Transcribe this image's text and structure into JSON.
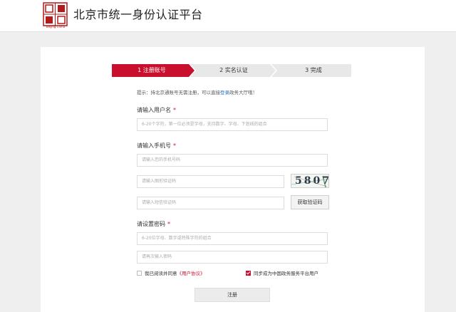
{
  "header": {
    "logo_caption": "Beijing China",
    "title": "北京市统一身份认证平台"
  },
  "steps": [
    {
      "label": "1 注册账号",
      "state": "active"
    },
    {
      "label": "2 实名认证",
      "state": "pending"
    },
    {
      "label": "3 完成",
      "state": "pending"
    }
  ],
  "colors": {
    "accent": "#c8102e",
    "step_inactive": "#e8e8e8",
    "link": "#2b6fc2"
  },
  "tip": {
    "prefix": "提示：持北京通账号无需注册，可以直接",
    "link": "登录",
    "suffix": "政务大厅哦！"
  },
  "form": {
    "username_label": "请输入用户名",
    "username_placeholder": "6-20个字符，第一位必须是字母，支持数字、字母、下划线的组合",
    "phone_label": "请输入手机号",
    "phone_placeholder": "请输入您的手机号码",
    "captcha_placeholder": "请输入图形验证码",
    "captcha_text": "5807",
    "sms_placeholder": "请输入短信验证码",
    "sms_button": "获取验证码",
    "password_label": "请设置密码",
    "password_placeholder": "6-20位字母、数字或特殊字符的组合",
    "confirm_placeholder": "请再次输入密码",
    "required_mark": "*"
  },
  "agreements": {
    "user_agreement_prefix": "我已阅读并同意",
    "user_agreement_link": "《用户协议》",
    "user_agreement_checked": false,
    "gov_service_text": "同步成为中国政务服务平台用户",
    "gov_service_checked": true
  },
  "submit_label": "注册"
}
